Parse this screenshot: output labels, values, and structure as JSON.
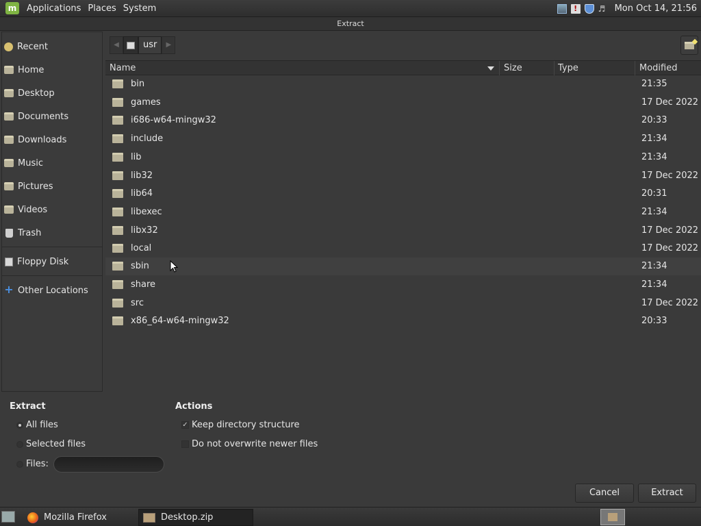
{
  "top_panel": {
    "logo": "m",
    "menus": [
      "Applications",
      "Places",
      "System"
    ],
    "clock": "Mon Oct 14, 21:56"
  },
  "dialog": {
    "title": "Extract"
  },
  "sidebar": {
    "items": [
      {
        "label": "Recent",
        "icon": "recent-icon"
      },
      {
        "label": "Home",
        "icon": "folder-icon"
      },
      {
        "label": "Desktop",
        "icon": "folder-icon"
      },
      {
        "label": "Documents",
        "icon": "folder-icon"
      },
      {
        "label": "Downloads",
        "icon": "folder-icon"
      },
      {
        "label": "Music",
        "icon": "folder-icon"
      },
      {
        "label": "Pictures",
        "icon": "folder-icon"
      },
      {
        "label": "Videos",
        "icon": "folder-icon"
      },
      {
        "label": "Trash",
        "icon": "trash-icon"
      }
    ],
    "devices": [
      {
        "label": "Floppy Disk",
        "icon": "floppy-icon"
      }
    ],
    "other": {
      "label": "Other Locations",
      "icon": "plus-icon"
    }
  },
  "path_bar": {
    "current": "usr"
  },
  "columns": {
    "name": "Name",
    "size": "Size",
    "type": "Type",
    "modified": "Modified"
  },
  "files": [
    {
      "name": "bin",
      "modified": "21:35"
    },
    {
      "name": "games",
      "modified": "17 Dec 2022"
    },
    {
      "name": "i686-w64-mingw32",
      "modified": "20:33"
    },
    {
      "name": "include",
      "modified": "21:34"
    },
    {
      "name": "lib",
      "modified": "21:34"
    },
    {
      "name": "lib32",
      "modified": "17 Dec 2022"
    },
    {
      "name": "lib64",
      "modified": "20:31"
    },
    {
      "name": "libexec",
      "modified": "21:34"
    },
    {
      "name": "libx32",
      "modified": "17 Dec 2022"
    },
    {
      "name": "local",
      "modified": "17 Dec 2022"
    },
    {
      "name": "sbin",
      "modified": "21:34"
    },
    {
      "name": "share",
      "modified": "21:34"
    },
    {
      "name": "src",
      "modified": "17 Dec 2022"
    },
    {
      "name": "x86_64-w64-mingw32",
      "modified": "20:33"
    }
  ],
  "extract_options": {
    "title": "Extract",
    "all_files": "All files",
    "selected_files": "Selected files",
    "files_label": "Files:",
    "selected": "all_files"
  },
  "actions": {
    "title": "Actions",
    "keep_structure": "Keep directory structure",
    "keep_structure_checked": true,
    "no_overwrite": "Do not overwrite newer files",
    "no_overwrite_checked": false
  },
  "buttons": {
    "cancel": "Cancel",
    "extract": "Extract"
  },
  "taskbar": {
    "items": [
      {
        "label": "Mozilla Firefox",
        "icon": "firefox-icon"
      },
      {
        "label": "Desktop.zip",
        "icon": "archive-icon"
      }
    ]
  }
}
